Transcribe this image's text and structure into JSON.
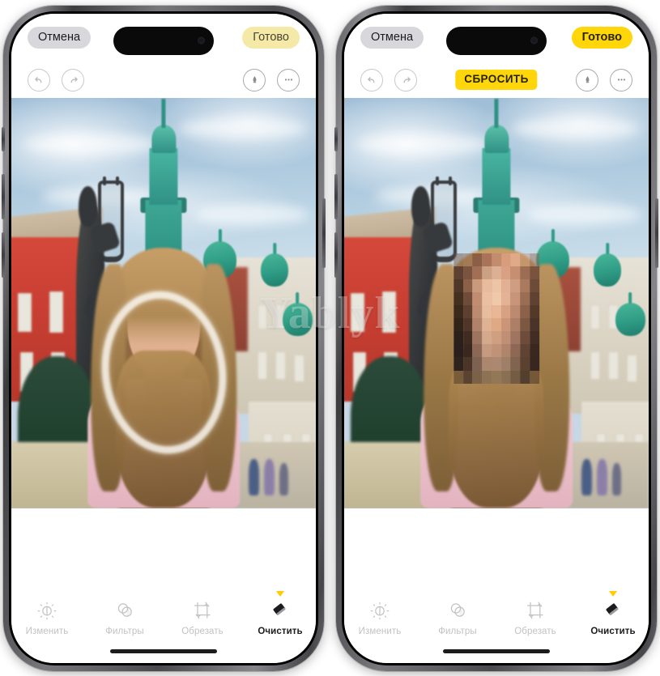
{
  "page": {
    "description": "Two iPhone screenshots side by side showing the iOS Photos app Clean Up (Очистить) tool: left phone shows a white brush stroke drawn around a girl's face, right phone shows the face pixelated after applying the tool.",
    "watermark": "Yablyk"
  },
  "phones": [
    {
      "id": "left",
      "nav": {
        "cancel_label": "Отмена",
        "done_label": "Готово",
        "done_state": "dim"
      },
      "edit_toolbar": {
        "undo_icon": "undo-icon",
        "redo_icon": "redo-icon",
        "markup_icon": "markup-pen-icon",
        "more_icon": "more-ellipsis-icon",
        "reset_label": "",
        "reset_visible": false
      },
      "photo": {
        "state": "brush-stroke-drawn",
        "overlay": "white-brush-ring-around-face"
      },
      "tools": [
        {
          "label": "Изменить",
          "icon": "adjust-dial-icon",
          "active": false
        },
        {
          "label": "Фильтры",
          "icon": "filters-circles-icon",
          "active": false
        },
        {
          "label": "Обрезать",
          "icon": "crop-rotate-icon",
          "active": false
        },
        {
          "label": "Очистить",
          "icon": "cleanup-eraser-icon",
          "active": true
        }
      ]
    },
    {
      "id": "right",
      "nav": {
        "cancel_label": "Отмена",
        "done_label": "Готово",
        "done_state": "active"
      },
      "edit_toolbar": {
        "undo_icon": "undo-icon",
        "redo_icon": "redo-icon",
        "markup_icon": "markup-pen-icon",
        "more_icon": "more-ellipsis-icon",
        "reset_label": "СБРОСИТЬ",
        "reset_visible": true
      },
      "photo": {
        "state": "face-pixelated",
        "overlay": "mosaic-pixelation-over-face"
      },
      "tools": [
        {
          "label": "Изменить",
          "icon": "adjust-dial-icon",
          "active": false
        },
        {
          "label": "Фильтры",
          "icon": "filters-circles-icon",
          "active": false
        },
        {
          "label": "Обрезать",
          "icon": "crop-rotate-icon",
          "active": false
        },
        {
          "label": "Очистить",
          "icon": "cleanup-eraser-icon",
          "active": true
        }
      ]
    }
  ],
  "colors": {
    "accent_yellow": "#ffd60a",
    "accent_yellow_dim": "#f5e9a8",
    "marker_yellow": "#ffcc00",
    "cancel_grey": "#d8d8dc",
    "tool_inactive": "#c2c2c6",
    "tool_active": "#1c1c1e",
    "frame_titanium": "#77777c"
  },
  "photo_scene": {
    "subject": "girl with long wavy blonde hair in pink t-shirt",
    "background": "city square with bronze lyre statue, green-domed baroque church tower, red building, fountain"
  }
}
